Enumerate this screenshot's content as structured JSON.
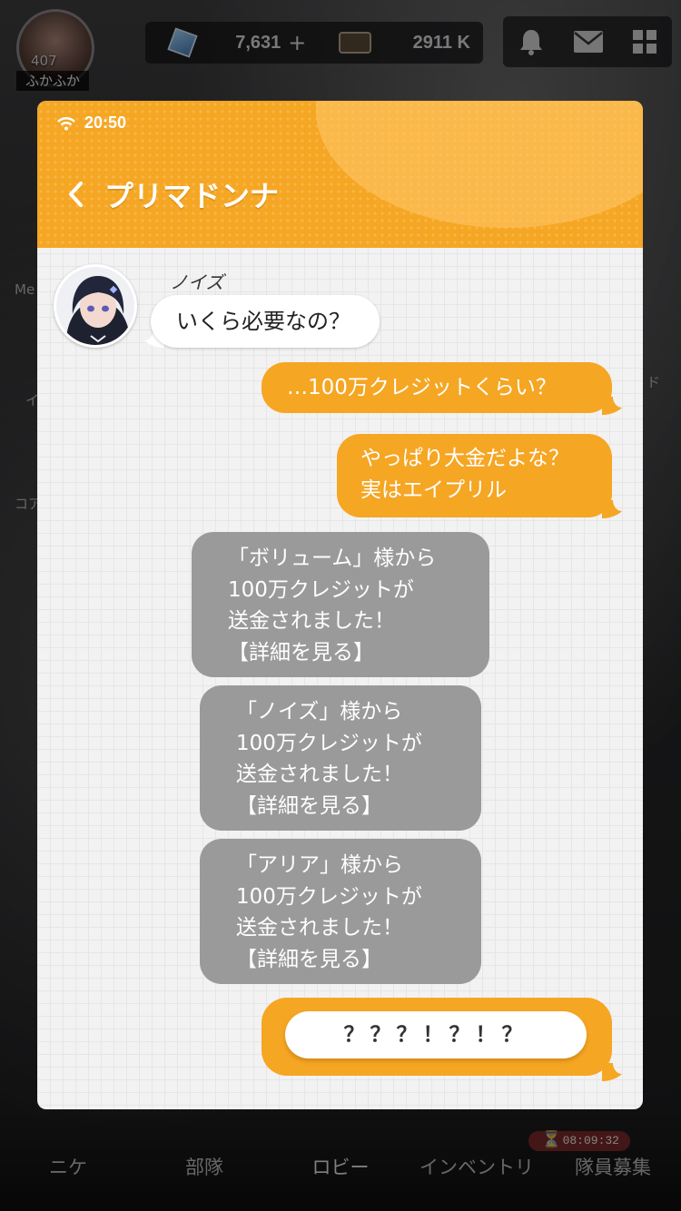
{
  "hud": {
    "level": "407",
    "player_name": "ふかふか",
    "gems": "7,631",
    "gems_plus": "+",
    "credits": "2911 K",
    "bell_icon": "bell-icon",
    "mail_icon": "mail-icon",
    "menu_icon": "grid-icon"
  },
  "side_labels": {
    "left1": "Me",
    "left2": "イ",
    "left3": "コア",
    "right1": "ド"
  },
  "bottom_nav": {
    "items": [
      {
        "label": "ニケ"
      },
      {
        "label": "部隊"
      },
      {
        "label": "ロビー"
      },
      {
        "label": "インベントリ"
      },
      {
        "label": "隊員募集"
      }
    ],
    "timer": "08:09:32"
  },
  "messenger": {
    "status_time": "20:50",
    "chat_title": "プリマドンナ",
    "accent_color": "#f5a623",
    "sender_name": "ノイズ",
    "messages": [
      {
        "from": "contact",
        "text": "いくら必要なの？"
      },
      {
        "from": "self",
        "text": "…100万クレジットくらい？"
      },
      {
        "from": "self",
        "lines": [
          "やっぱり大金だよな？",
          "実はエイプリル"
        ]
      },
      {
        "from": "system",
        "lines": [
          "「ボリューム」様から",
          "100万クレジットが",
          "送金されました！",
          "【詳細を見る】"
        ]
      },
      {
        "from": "system",
        "lines": [
          "「ノイズ」様から",
          "100万クレジットが",
          "送金されました！",
          "【詳細を見る】"
        ]
      },
      {
        "from": "system",
        "lines": [
          "「アリア」様から",
          "100万クレジットが",
          "送金されました！",
          "【詳細を見る】"
        ]
      }
    ],
    "reply_option": "？？？！？！？"
  }
}
